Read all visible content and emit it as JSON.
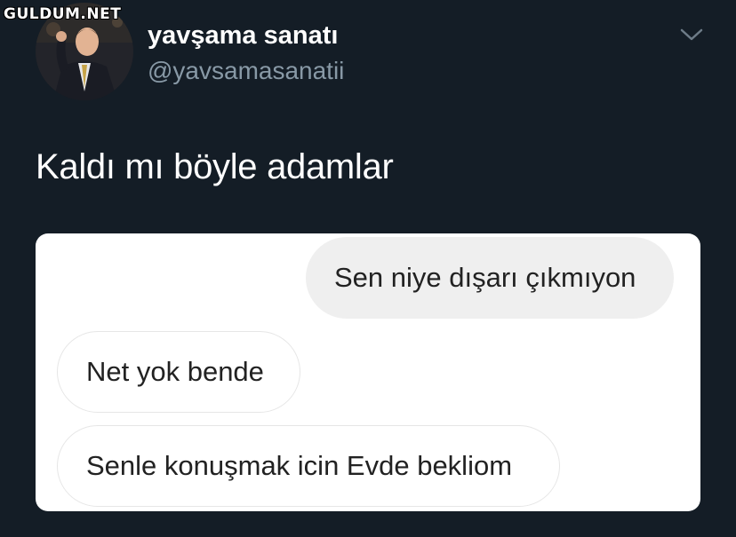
{
  "watermark": "GULDUM.NET",
  "tweet": {
    "display_name": "yavşama sanatı",
    "handle": "@yavsamasanatii",
    "text": "Kaldı mı böyle adamlar",
    "menu_icon": "chevron-down-icon"
  },
  "chat": {
    "messages": [
      {
        "direction": "sent",
        "text": "Sen niye dışarı çıkmıyon"
      },
      {
        "direction": "received",
        "text": "Net yok bende"
      },
      {
        "direction": "received",
        "text": "Senle konuşmak icin Evde bekliom"
      }
    ]
  },
  "colors": {
    "background": "#141d26",
    "handle": "#8899a6",
    "sent_bubble": "#efefef",
    "received_border": "#e6e6e6"
  }
}
